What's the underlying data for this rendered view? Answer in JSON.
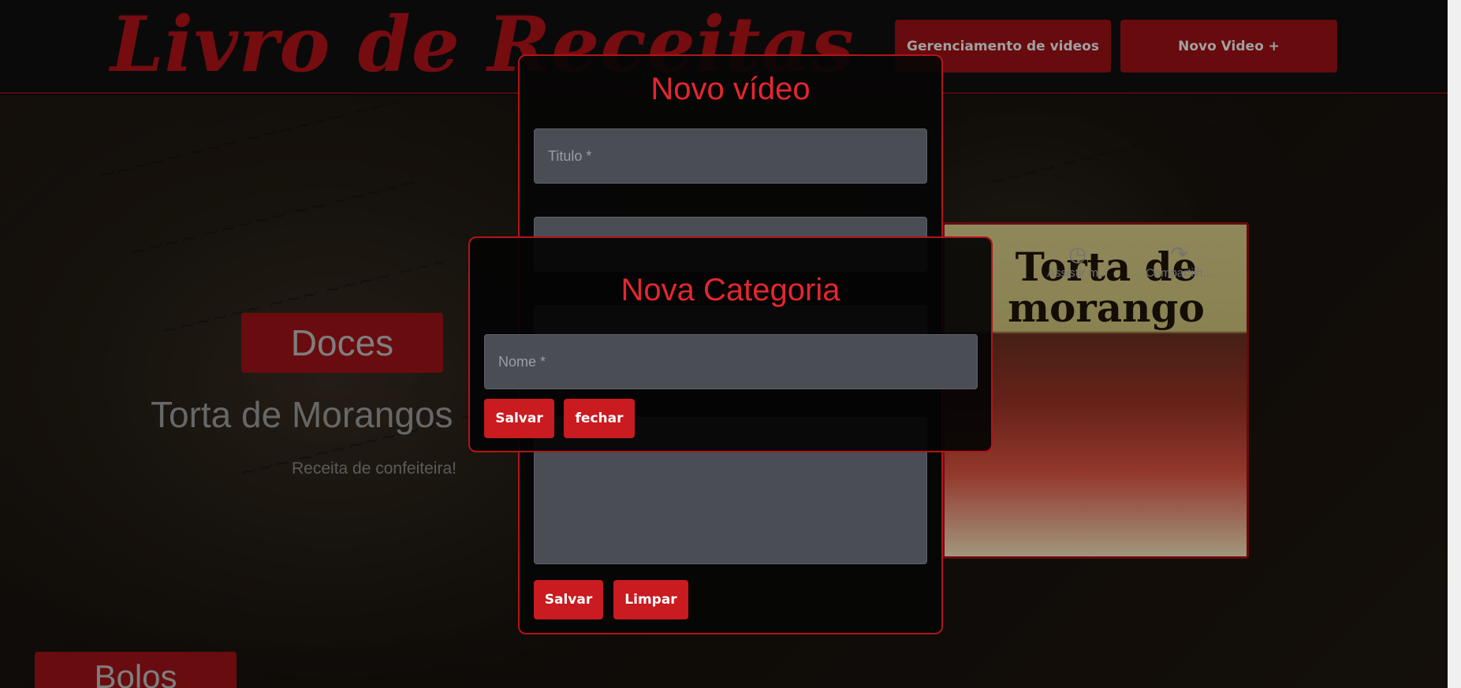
{
  "header": {
    "logo": "Livro de Receitas",
    "buttons": {
      "manage": "Gerenciamento de videos",
      "new_video": "Novo Video +"
    }
  },
  "banner": {
    "category": "Doces",
    "title": "Torta de Morangos",
    "description": "Receita de confeiteira!",
    "video": {
      "thumbnail_title_line1": "Torta de",
      "thumbnail_title_line2": "morango",
      "watch_later": "Assistir m...",
      "share": "Compartilh..."
    }
  },
  "next_category": "Bolos",
  "modal_video": {
    "title": "Novo vídeo",
    "fields": {
      "titulo_placeholder": "Titulo *"
    },
    "buttons": {
      "save": "Salvar",
      "clear": "Limpar"
    }
  },
  "modal_categoria": {
    "title": "Nova Categoria",
    "fields": {
      "nome_placeholder": "Nome *"
    },
    "buttons": {
      "save": "Salvar",
      "close": "fechar"
    }
  },
  "colors": {
    "accent": "#c91b20",
    "title_red": "#e5262e",
    "dark_red": "#8a0f14"
  }
}
